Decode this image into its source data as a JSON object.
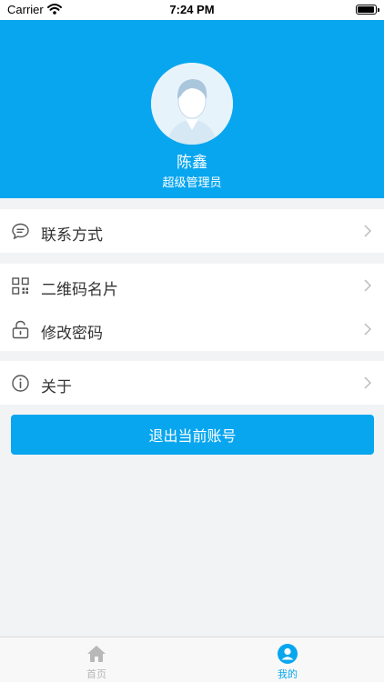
{
  "status_bar": {
    "carrier": "Carrier",
    "time": "7:24 PM"
  },
  "profile": {
    "name": "陈鑫",
    "role": "超级管理员"
  },
  "menu": {
    "contact": "联系方式",
    "qrcode": "二维码名片",
    "password": "修改密码",
    "about": "关于"
  },
  "logout_label": "退出当前账号",
  "tabbar": {
    "home": "首页",
    "mine": "我的"
  },
  "colors": {
    "accent": "#08a6ef",
    "background": "#f2f3f5"
  },
  "icons": [
    "wifi-icon",
    "battery-icon",
    "avatar",
    "chat-bubble-icon",
    "qr-code-icon",
    "unlock-icon",
    "info-icon",
    "chevron-right-icon",
    "home-icon",
    "user-icon"
  ]
}
